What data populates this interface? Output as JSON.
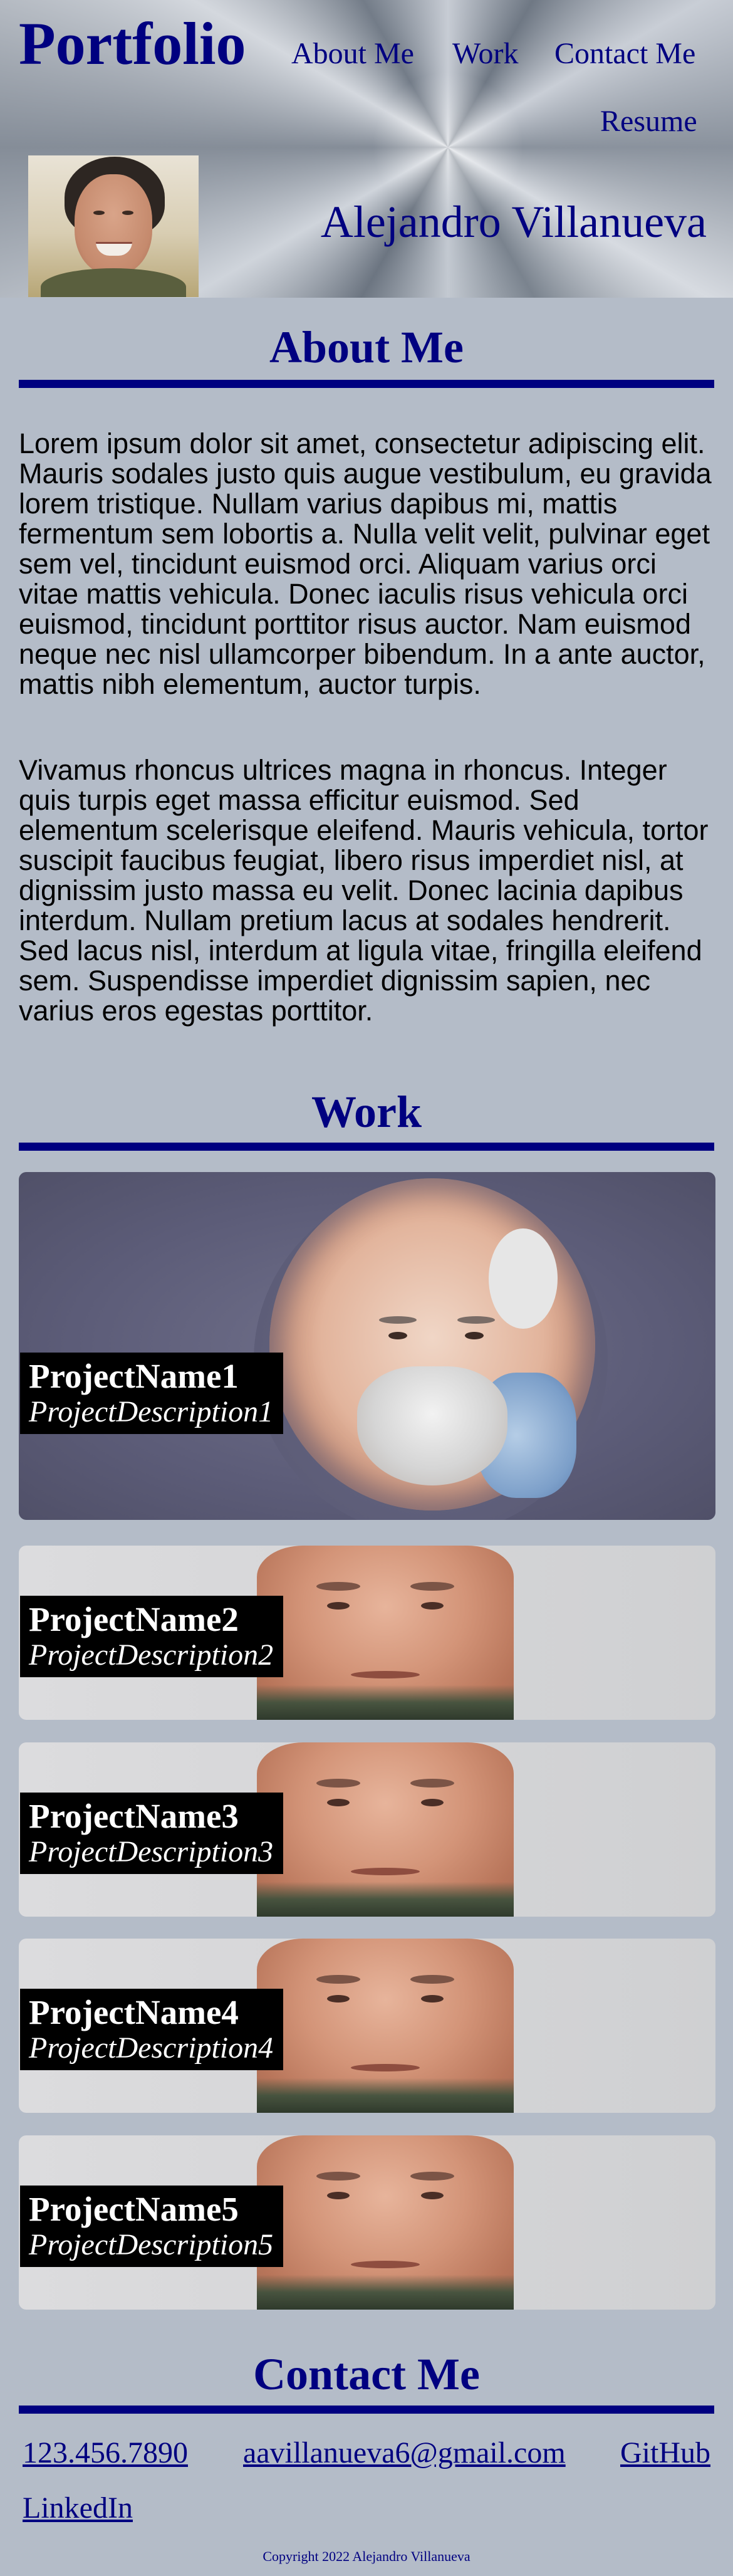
{
  "header": {
    "brand": "Portfolio",
    "nav": {
      "about": "About Me",
      "work": "Work",
      "contact": "Contact Me",
      "resume": "Resume"
    },
    "name": "Alejandro Villanueva"
  },
  "about": {
    "title": "About Me",
    "paragraphs": [
      "Lorem ipsum dolor sit amet, consectetur adipiscing elit. Mauris sodales justo quis augue vestibulum, eu gravida lorem tristique. Nullam varius dapibus mi, mattis fermentum sem lobortis a. Nulla velit velit, pulvinar eget sem vel, tincidunt euismod orci. Aliquam varius orci vitae mattis vehicula. Donec iaculis risus vehicula orci euismod, tincidunt porttitor risus auctor. Nam euismod neque nec nisl ullamcorper bibendum. In a ante auctor, mattis nibh elementum, auctor turpis.",
      "Vivamus rhoncus ultrices magna in rhoncus. Integer quis turpis eget massa efficitur euismod. Sed elementum scelerisque eleifend. Mauris vehicula, tortor suscipit faucibus feugiat, libero risus imperdiet nisl, at dignissim justo massa eu velit. Donec lacinia dapibus interdum. Nullam pretium lacus at sodales hendrerit. Sed lacus nisl, interdum at ligula vitae, fringilla eleifend sem. Suspendisse imperdiet dignissim sapien, nec varius eros egestas porttitor."
    ]
  },
  "work": {
    "title": "Work",
    "projects": [
      {
        "name": "ProjectName1",
        "description": "ProjectDescription1"
      },
      {
        "name": "ProjectName2",
        "description": "ProjectDescription2"
      },
      {
        "name": "ProjectName3",
        "description": "ProjectDescription3"
      },
      {
        "name": "ProjectName4",
        "description": "ProjectDescription4"
      },
      {
        "name": "ProjectName5",
        "description": "ProjectDescription5"
      }
    ]
  },
  "contact": {
    "title": "Contact Me",
    "phone": "123.456.7890",
    "email": "aavillanueva6@gmail.com",
    "github": "GitHub",
    "linkedin": "LinkedIn"
  },
  "footer": {
    "copyright": "Copyright 2022 Alejandro Villanueva"
  },
  "colors": {
    "accent": "#000080",
    "background": "#b4bcc8",
    "caption_bg": "#000000"
  }
}
